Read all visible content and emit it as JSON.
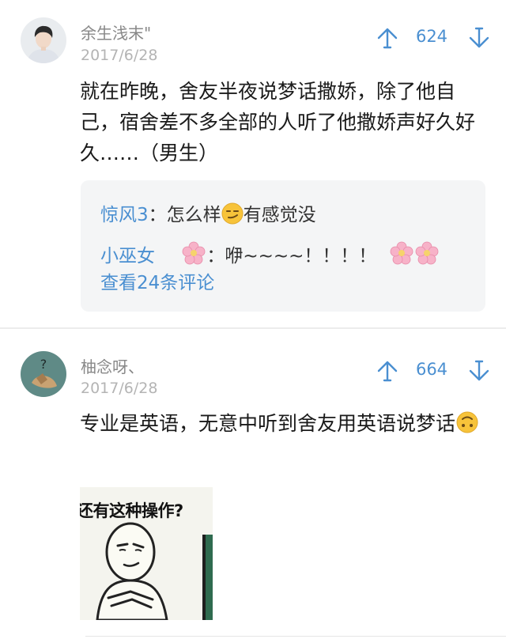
{
  "colors": {
    "accent": "#4a8fd1",
    "username": "#888888",
    "date": "#b4b4b4",
    "reply_bg": "#f4f5f6"
  },
  "comments": [
    {
      "username": "余生浅末\"",
      "date": "2017/6/28",
      "likes": "624",
      "text": "就在昨晚，舍友半夜说梦话撒娇，除了他自己，宿舍差不多全部的人听了他撒娇声好久好久……（男生）",
      "replies": [
        {
          "nick": "惊风3",
          "sep": "：",
          "text_before": "怎么样",
          "emoji": "smirk-emoji",
          "text_after": "有感觉没"
        },
        {
          "nick": "小巫女",
          "nick_emoji": "cherry-blossom-emoji",
          "sep": "：",
          "text": "咿~~~~！！！！",
          "emojis": "cherry-blossom-emoji x2"
        }
      ],
      "more_replies": "查看24条评论"
    },
    {
      "username": "柚念呀、",
      "date": "2017/6/28",
      "likes": "664",
      "text": "专业是英语，无意中听到舍友用英语说梦话",
      "emoji": "upside-down-face-emoji",
      "image_caption": "还有这种操作?"
    }
  ],
  "icons": {
    "upvote": "arrow-up-icon",
    "downvote": "arrow-down-icon"
  }
}
